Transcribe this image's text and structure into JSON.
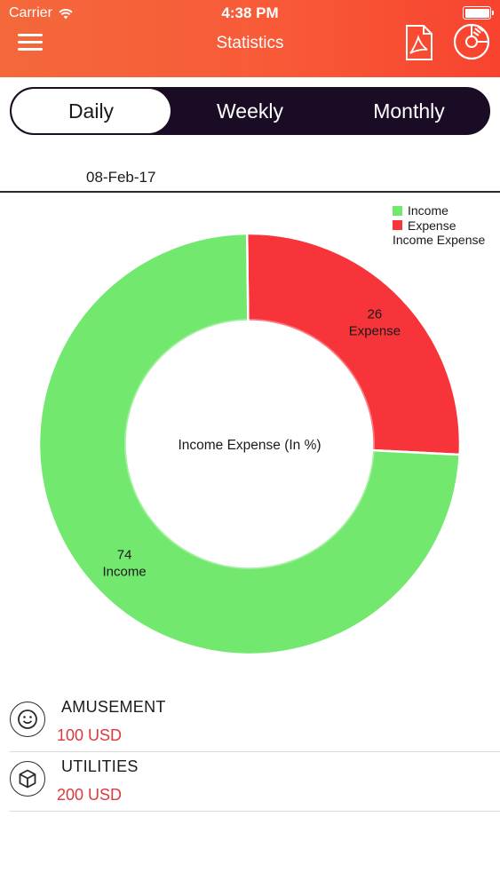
{
  "status_bar": {
    "carrier": "Carrier",
    "time": "4:38 PM"
  },
  "header": {
    "title": "Statistics",
    "menu_icon": "hamburger-menu-icon",
    "pdf_icon": "pdf-icon",
    "chart_icon": "pie-chart-icon",
    "gradient_start": "#f4683b",
    "gradient_end": "#f8432f"
  },
  "tabs": [
    {
      "label": "Daily",
      "active": true
    },
    {
      "label": "Weekly",
      "active": false
    },
    {
      "label": "Monthly",
      "active": false
    }
  ],
  "date": "08-Feb-17",
  "chart_data": {
    "type": "pie",
    "donut": true,
    "center_label": "Income Expense (In %)",
    "categories": [
      "Income",
      "Expense"
    ],
    "values": [
      74,
      26
    ],
    "colors": [
      "#73e86e",
      "#f8343b"
    ],
    "slice_labels": [
      {
        "value": "74",
        "name": "Income"
      },
      {
        "value": "26",
        "name": "Expense"
      }
    ],
    "legend": {
      "placement": "top-right",
      "entries": [
        "Income",
        "Expense"
      ],
      "title": "Income Expense"
    }
  },
  "transactions": [
    {
      "category": "AMUSEMENT",
      "amount": "100 USD",
      "icon": "smiley-face-icon"
    },
    {
      "category": "UTILITIES",
      "amount": "200 USD",
      "icon": "box-icon"
    }
  ]
}
